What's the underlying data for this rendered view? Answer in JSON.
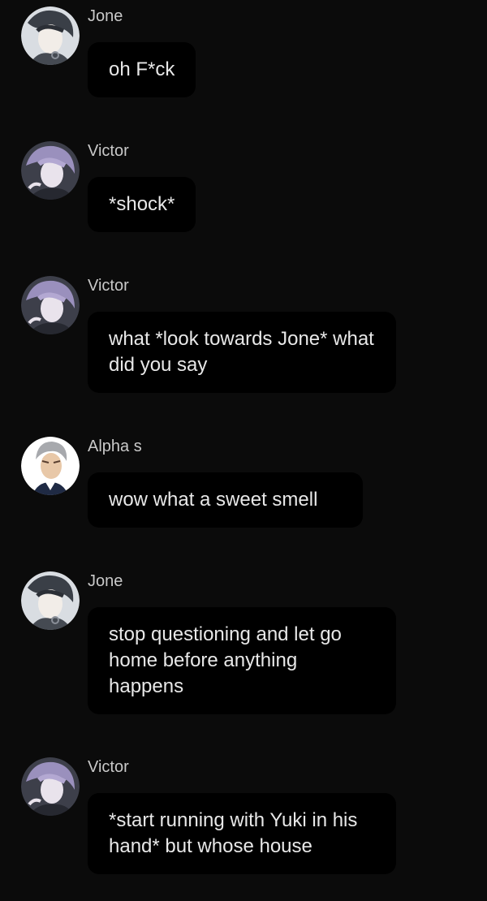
{
  "theme": {
    "background": "#0b0b0b",
    "bubble": "#000000",
    "text": "#e8e8e8",
    "name": "#c9c9c9"
  },
  "messages": [
    {
      "sender": "Jone",
      "avatar": "jone-avatar",
      "text": "oh F*ck"
    },
    {
      "sender": "Victor",
      "avatar": "victor-avatar",
      "text": "*shock*"
    },
    {
      "sender": "Victor",
      "avatar": "victor-avatar",
      "text": "what *look towards Jone* what did you say"
    },
    {
      "sender": "Alpha s",
      "avatar": "alpha-avatar",
      "text": "wow what a sweet smell"
    },
    {
      "sender": "Jone",
      "avatar": "jone-avatar",
      "text": "stop questioning and let go home before anything happens"
    },
    {
      "sender": "Victor",
      "avatar": "victor-avatar",
      "text": "*start running with Yuki in his hand* but whose house"
    }
  ]
}
